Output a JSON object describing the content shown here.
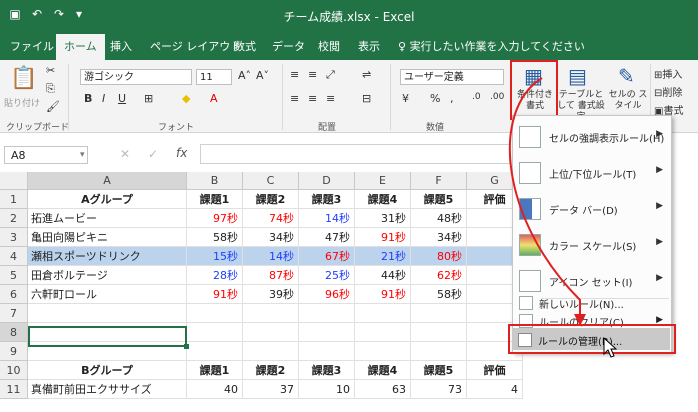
{
  "window": {
    "title": "チーム成績.xlsx  -  Excel"
  },
  "tabs": [
    "ファイル",
    "ホーム",
    "挿入",
    "ページ レイアウト",
    "数式",
    "データ",
    "校閲",
    "表示"
  ],
  "tell_me": "実行したい作業を入力してください",
  "ribbon": {
    "paste_label": "貼り付け",
    "font_name": "游ゴシック",
    "font_size": "11",
    "number_format": "ユーザー定義",
    "cond_format_label": "条件付き 書式",
    "table_format_label": "テーブルとして 書式設定",
    "cell_style_label": "セルの スタイル",
    "insert_label": "挿入",
    "delete_label": "削除",
    "format_label": "書式",
    "groups": [
      "クリップボード",
      "フォント",
      "配置",
      "数値"
    ]
  },
  "formula_bar": {
    "name_box": "A8",
    "fx": "fx"
  },
  "columns": [
    "A",
    "B",
    "C",
    "D",
    "E",
    "F",
    "G"
  ],
  "rows": [
    {
      "n": "1",
      "cells": [
        {
          "v": "Aグループ",
          "c": "hdr"
        },
        {
          "v": "課題1",
          "c": "hdr"
        },
        {
          "v": "課題2",
          "c": "hdr"
        },
        {
          "v": "課題3",
          "c": "hdr"
        },
        {
          "v": "課題4",
          "c": "hdr"
        },
        {
          "v": "課題5",
          "c": "hdr"
        },
        {
          "v": "評価",
          "c": "hdr"
        }
      ]
    },
    {
      "n": "2",
      "cells": [
        {
          "v": "拓進ムービー",
          "c": "txt"
        },
        {
          "v": "97秒",
          "c": "num red"
        },
        {
          "v": "74秒",
          "c": "num red"
        },
        {
          "v": "14秒",
          "c": "num blue"
        },
        {
          "v": "31秒",
          "c": "num blk"
        },
        {
          "v": "48秒",
          "c": "num blk"
        },
        {
          "v": "",
          "c": ""
        }
      ]
    },
    {
      "n": "3",
      "cells": [
        {
          "v": "亀田向陽ピキニ",
          "c": "txt"
        },
        {
          "v": "58秒",
          "c": "num blk"
        },
        {
          "v": "34秒",
          "c": "num blk"
        },
        {
          "v": "47秒",
          "c": "num blk"
        },
        {
          "v": "91秒",
          "c": "num red"
        },
        {
          "v": "34秒",
          "c": "num blk"
        },
        {
          "v": "",
          "c": ""
        }
      ]
    },
    {
      "n": "4",
      "cells": [
        {
          "v": "瀬相スポーツドリンク",
          "c": "txt"
        },
        {
          "v": "15秒",
          "c": "num blue"
        },
        {
          "v": "14秒",
          "c": "num blue"
        },
        {
          "v": "67秒",
          "c": "num red"
        },
        {
          "v": "21秒",
          "c": "num blue"
        },
        {
          "v": "80秒",
          "c": "num red"
        },
        {
          "v": "",
          "c": ""
        }
      ]
    },
    {
      "n": "5",
      "cells": [
        {
          "v": "田倉ボルテージ",
          "c": "txt"
        },
        {
          "v": "28秒",
          "c": "num blue"
        },
        {
          "v": "87秒",
          "c": "num red"
        },
        {
          "v": "25秒",
          "c": "num blue"
        },
        {
          "v": "44秒",
          "c": "num blk"
        },
        {
          "v": "62秒",
          "c": "num red"
        },
        {
          "v": "",
          "c": ""
        }
      ]
    },
    {
      "n": "6",
      "cells": [
        {
          "v": "六軒町ロール",
          "c": "txt"
        },
        {
          "v": "91秒",
          "c": "num red"
        },
        {
          "v": "39秒",
          "c": "num blk"
        },
        {
          "v": "96秒",
          "c": "num red"
        },
        {
          "v": "91秒",
          "c": "num red"
        },
        {
          "v": "58秒",
          "c": "num blk"
        },
        {
          "v": "",
          "c": ""
        }
      ]
    },
    {
      "n": "7",
      "cells": [
        {
          "v": "",
          "c": ""
        },
        {
          "v": "",
          "c": ""
        },
        {
          "v": "",
          "c": ""
        },
        {
          "v": "",
          "c": ""
        },
        {
          "v": "",
          "c": ""
        },
        {
          "v": "",
          "c": ""
        },
        {
          "v": "",
          "c": ""
        }
      ]
    },
    {
      "n": "8",
      "cells": [
        {
          "v": "",
          "c": ""
        },
        {
          "v": "",
          "c": ""
        },
        {
          "v": "",
          "c": ""
        },
        {
          "v": "",
          "c": ""
        },
        {
          "v": "",
          "c": ""
        },
        {
          "v": "",
          "c": ""
        },
        {
          "v": "",
          "c": ""
        }
      ]
    },
    {
      "n": "9",
      "cells": [
        {
          "v": "",
          "c": ""
        },
        {
          "v": "",
          "c": ""
        },
        {
          "v": "",
          "c": ""
        },
        {
          "v": "",
          "c": ""
        },
        {
          "v": "",
          "c": ""
        },
        {
          "v": "",
          "c": ""
        },
        {
          "v": "",
          "c": ""
        }
      ]
    },
    {
      "n": "10",
      "cells": [
        {
          "v": "Bグループ",
          "c": "hdr"
        },
        {
          "v": "課題1",
          "c": "hdr"
        },
        {
          "v": "課題2",
          "c": "hdr"
        },
        {
          "v": "課題3",
          "c": "hdr"
        },
        {
          "v": "課題4",
          "c": "hdr"
        },
        {
          "v": "課題5",
          "c": "hdr"
        },
        {
          "v": "評価",
          "c": "hdr"
        }
      ]
    },
    {
      "n": "11",
      "cells": [
        {
          "v": "真備町前田エクササイズ",
          "c": "txt"
        },
        {
          "v": "40",
          "c": "num blk"
        },
        {
          "v": "37",
          "c": "num blk"
        },
        {
          "v": "10",
          "c": "num blk"
        },
        {
          "v": "63",
          "c": "num blk"
        },
        {
          "v": "73",
          "c": "num blk"
        },
        {
          "v": "4",
          "c": "num blk"
        }
      ]
    }
  ],
  "menu": {
    "items": [
      {
        "label": "セルの強調表示ルール(H)",
        "icon": "highlight-rules-icon"
      },
      {
        "label": "上位/下位ルール(T)",
        "icon": "top-bottom-rules-icon"
      },
      {
        "label": "データ バー(D)",
        "icon": "data-bars-icon"
      },
      {
        "label": "カラー スケール(S)",
        "icon": "color-scales-icon"
      },
      {
        "label": "アイコン セット(I)",
        "icon": "icon-sets-icon"
      }
    ],
    "small": [
      {
        "label": "新しいルール(N)..."
      },
      {
        "label": "ルールのクリア(C)"
      },
      {
        "label": "ルールの管理(R)..."
      }
    ]
  }
}
